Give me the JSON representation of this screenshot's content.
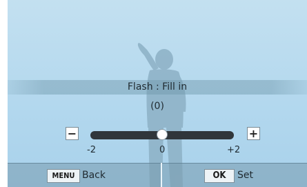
{
  "setting": {
    "title": "Flash : Fill in",
    "value_display": "(0)",
    "level": 0
  },
  "slider": {
    "min_label": "-2",
    "mid_label": "0",
    "max_label": "+2",
    "minus_symbol": "−",
    "plus_symbol": "+"
  },
  "footer": {
    "menu_key": "MENU",
    "back_label": "Back",
    "ok_key": "OK",
    "set_label": "Set"
  }
}
